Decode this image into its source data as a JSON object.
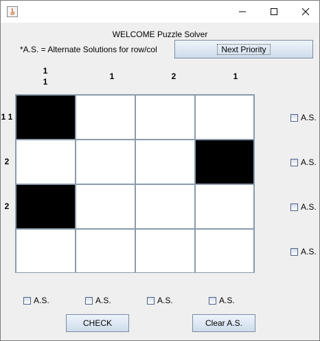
{
  "window": {
    "title_icon": "java-app-icon",
    "controls": [
      "minimize-icon",
      "maximize-icon",
      "close-icon"
    ]
  },
  "header": {
    "title": "WELCOME Puzzle Solver",
    "legend": "*A.S. = Alternate Solutions for row/col",
    "next_priority_label": "Next Priority"
  },
  "column_clues": [
    [
      "1",
      "1"
    ],
    [
      "1"
    ],
    [
      "2"
    ],
    [
      "1"
    ]
  ],
  "row_clues": [
    "1 1",
    "2",
    "2",
    ""
  ],
  "grid": {
    "rows": 4,
    "cols": 4,
    "cells": [
      [
        1,
        0,
        0,
        0
      ],
      [
        0,
        0,
        0,
        1
      ],
      [
        1,
        0,
        0,
        0
      ],
      [
        0,
        0,
        0,
        0
      ]
    ],
    "filled_color": "#000000",
    "empty_color": "#ffffff"
  },
  "row_alt_checkboxes": [
    {
      "label": "A.S.",
      "checked": false
    },
    {
      "label": "A.S.",
      "checked": false
    },
    {
      "label": "A.S.",
      "checked": false
    },
    {
      "label": "A.S.",
      "checked": false
    }
  ],
  "col_alt_checkboxes": [
    {
      "label": "A.S.",
      "checked": false
    },
    {
      "label": "A.S.",
      "checked": false
    },
    {
      "label": "A.S.",
      "checked": false
    },
    {
      "label": "A.S.",
      "checked": false
    }
  ],
  "footer": {
    "check_label": "CHECK",
    "clear_label": "Clear A.S."
  }
}
